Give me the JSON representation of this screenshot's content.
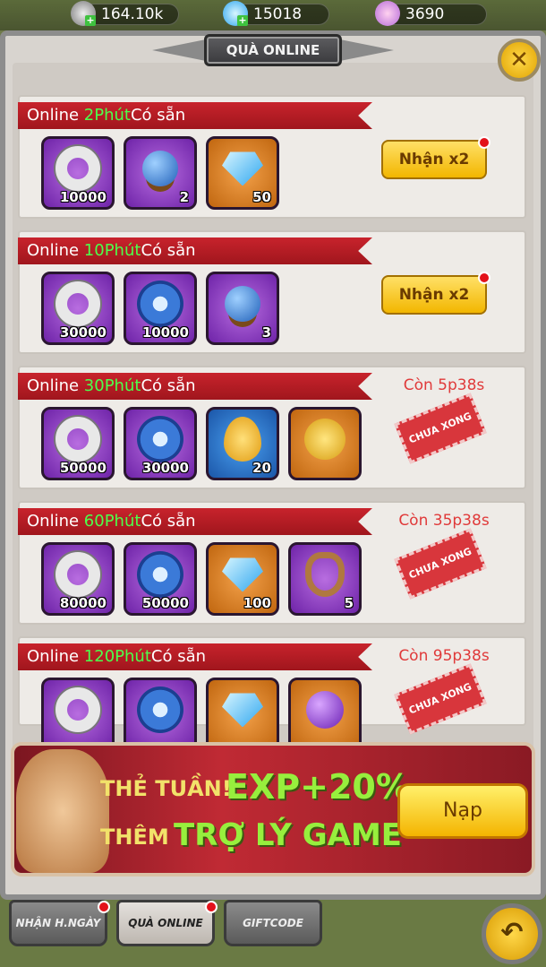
{
  "currency": [
    {
      "icon": "stone-ring-icon",
      "value": "164.10k"
    },
    {
      "icon": "diamond-icon",
      "value": "15018"
    },
    {
      "icon": "shell-icon",
      "value": "3690"
    }
  ],
  "title": "QUÀ ONLINE",
  "close_label": "✕",
  "rows": [
    {
      "prefix": "Online ",
      "minutes": "2Phút",
      "suffix": "Có sẵn",
      "items": [
        {
          "icon": "stone-ring-icon",
          "bg": "purple",
          "qty": "10000"
        },
        {
          "icon": "blue-orb-icon",
          "bg": "purple",
          "qty": "2"
        },
        {
          "icon": "diamond-icon",
          "bg": "orange",
          "qty": "50"
        }
      ],
      "action": {
        "type": "claim",
        "label": "Nhận x2"
      }
    },
    {
      "prefix": "Online ",
      "minutes": "10Phút",
      "suffix": "Có sẵn",
      "items": [
        {
          "icon": "stone-ring-icon",
          "bg": "purple",
          "qty": "30000"
        },
        {
          "icon": "blue-swirl-icon",
          "bg": "purple",
          "qty": "10000"
        },
        {
          "icon": "blue-orb-icon",
          "bg": "purple",
          "qty": "3"
        }
      ],
      "action": {
        "type": "claim",
        "label": "Nhận x2"
      }
    },
    {
      "prefix": "Online ",
      "minutes": "30Phút",
      "suffix": "Có sẵn",
      "items": [
        {
          "icon": "stone-ring-icon",
          "bg": "purple",
          "qty": "50000"
        },
        {
          "icon": "blue-swirl-icon",
          "bg": "purple",
          "qty": "30000"
        },
        {
          "icon": "flame-drop-icon",
          "bg": "blue",
          "qty": "20"
        },
        {
          "icon": "golden-egg-icon",
          "bg": "orange",
          "qty": ""
        }
      ],
      "action": {
        "type": "pending",
        "timer": "Còn  5p38s",
        "stamp": "CHƯA XONG"
      }
    },
    {
      "prefix": "Online ",
      "minutes": "60Phút",
      "suffix": "Có sẵn",
      "items": [
        {
          "icon": "stone-ring-icon",
          "bg": "purple",
          "qty": "80000"
        },
        {
          "icon": "blue-swirl-icon",
          "bg": "purple",
          "qty": "50000"
        },
        {
          "icon": "diamond-icon",
          "bg": "orange",
          "qty": "100"
        },
        {
          "icon": "rope-icon",
          "bg": "purple",
          "qty": "5"
        }
      ],
      "action": {
        "type": "pending",
        "timer": "Còn  35p38s",
        "stamp": "CHƯA XONG"
      }
    },
    {
      "prefix": "Online ",
      "minutes": "120Phút",
      "suffix": "Có sẵn",
      "items": [
        {
          "icon": "stone-ring-icon",
          "bg": "purple",
          "qty": ""
        },
        {
          "icon": "blue-swirl-icon",
          "bg": "purple",
          "qty": ""
        },
        {
          "icon": "diamond-icon",
          "bg": "orange",
          "qty": ""
        },
        {
          "icon": "purple-orb-icon",
          "bg": "orange",
          "qty": ""
        }
      ],
      "action": {
        "type": "pending",
        "timer": "Còn  95p38s",
        "stamp": "CHƯA XONG"
      }
    }
  ],
  "banner": {
    "line1": "THẺ TUẦN!",
    "line1_big": "EXP+20%",
    "line2": "THÊM",
    "line2_big": "TRỢ LÝ GAME",
    "button": "Nạp"
  },
  "tabs": [
    {
      "label": "NHẬN H.NGÀY",
      "active": false,
      "badge": true
    },
    {
      "label": "QUÀ ONLINE",
      "active": true,
      "badge": true
    },
    {
      "label": "GIFTCODE",
      "active": false,
      "badge": false
    }
  ],
  "back_label": "↶",
  "colors": {
    "ribbon": "#b81c25",
    "minutes": "#4cff4c",
    "timer": "#e03a3a",
    "claim": "#f2b600"
  }
}
